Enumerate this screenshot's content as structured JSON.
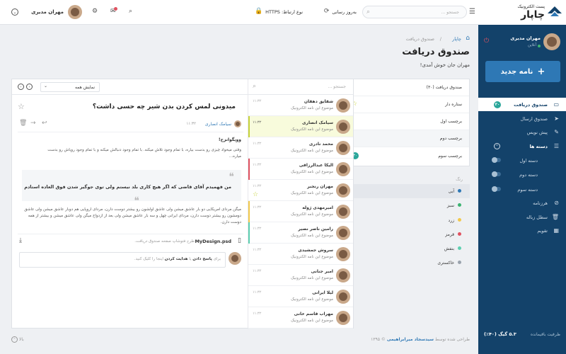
{
  "brand": {
    "tagline": "پست الکترونیک",
    "name": "چاپار"
  },
  "topbar": {
    "search_placeholder": "جستجو ...",
    "refresh_label": "به‌روز رسانی",
    "connection_label": "نوع ارتباط: HTTPS",
    "user_name": "مهران مدیری"
  },
  "sidebar": {
    "user_name": "مهران مدیری",
    "status": "آنلاین",
    "new_button": "نامه جدید",
    "items": [
      {
        "label": "صندوق دریافت",
        "icon": "inbox-icon",
        "badge": "۳۰"
      },
      {
        "label": "صندوق ارسال",
        "icon": "send-icon"
      },
      {
        "label": "پیش نویس",
        "icon": "draft-icon"
      },
      {
        "label": "دسته ها",
        "icon": "categories-icon"
      },
      {
        "label": "دسته اول",
        "icon": "dot"
      },
      {
        "label": "دسته دوم",
        "icon": "dot"
      },
      {
        "label": "دسته سوم",
        "icon": "dot"
      },
      {
        "label": "هرزنامه",
        "icon": "spam-icon"
      },
      {
        "label": "سطل زباله",
        "icon": "trash-icon"
      },
      {
        "label": "تقویم",
        "icon": "calendar-icon"
      }
    ],
    "storage_label": "ظرفیت باقیمانده",
    "storage_value": "۵.۳ گیگ (۴۰٪)"
  },
  "page": {
    "breadcrumb_home": "چاپار",
    "breadcrumb_current": "صندوق دریافت",
    "title": "صندوق دریافت",
    "subtitle": "مهران جان خوش آمدی!"
  },
  "labels_panel": {
    "header": "صندوق دریافت (۳۰)",
    "items": [
      "ستاره دار",
      "برچسب اول",
      "برچسب دوم",
      "برچسب سوم"
    ],
    "badge": "۳۰",
    "colors_title": "رنگ",
    "colors": [
      {
        "name": "آبی",
        "color": "#2e78b5"
      },
      {
        "name": "سبز",
        "color": "#3cb371"
      },
      {
        "name": "زرد",
        "color": "#f2c94c"
      },
      {
        "name": "قرمز",
        "color": "#e05260"
      },
      {
        "name": "بنفش",
        "color": "#5dcfb0"
      },
      {
        "name": "خاکستری",
        "color": "#9aa3ad"
      }
    ]
  },
  "list": {
    "search_placeholder": "جستجو ...",
    "filter_label": "نمایش همه",
    "messages": [
      {
        "name": "شقایق دهقان",
        "subject": "موضوع این نامه الکترونیک",
        "time": "۱۱:۳۲"
      },
      {
        "name": "سیامک انصاری",
        "subject": "موضوع این نامه الکترونیک",
        "time": "۱۱:۳۲"
      },
      {
        "name": "محمد نادری",
        "subject": "موضوع این نامه الکترونیک",
        "time": "۱۱:۳۲"
      },
      {
        "name": "الیکا عبدالرزاقی",
        "subject": "موضوع این نامه الکترونیک",
        "time": "۱۱:۳۲"
      },
      {
        "name": "مهران رنجبر",
        "subject": "موضوع این نامه الکترونیک",
        "time": "۱۱:۳۲"
      },
      {
        "name": "امیرمهدی ژوله",
        "subject": "موضوع این نامه الکترونیک",
        "time": "۱۱:۳۲"
      },
      {
        "name": "رامین ناصر نصیر",
        "subject": "موضوع این نامه الکترونیک",
        "time": "۱۱:۳۲"
      },
      {
        "name": "سروش جمشیدی",
        "subject": "موضوع این نامه الکترونیک",
        "time": "۱۱:۳۲"
      },
      {
        "name": "امیر جنانی",
        "subject": "موضوع این نامه الکترونیک",
        "time": "۱۱:۳۲"
      },
      {
        "name": "لیلا ایرانی",
        "subject": "موضوع این نامه الکترونیک",
        "time": "۱۱:۳۲"
      },
      {
        "name": "مهراب قاسم خانی",
        "subject": "موضوع این نامه الکترونیک",
        "time": "۱۱:۳۲"
      }
    ]
  },
  "reader": {
    "subject": "میدونی لمس کردن بدن شیر چه حسی داشت؟",
    "sender": "سیامک انصاری",
    "time": "۱۱:۳۲",
    "greeting": "وویگوانزح!",
    "body": "وقتی میخواد چیزی رو بدست بیاره، با تمام وجود تلاش میکنه. با تمام وجود دنبالش میکنه و با تمام وجود رویاش رو بدست میاره...",
    "quote1": "من فهمیدم آقای قاضی که اگر هیچ کاری بلد نیستم ولی توی جوگیر شدن فوق العاده استادم",
    "quote2": "میگن مردای امریکایی دو بار عاشق میشن ولی عاشق اولشون رو بیشتر دوست دارن، مردای اروپایی هم دوبار عاشق میشن ولی عاشق دومشون رو بیشتر دوست دارن، مردای ایرانی چهل و سه بار عاشق میشن ولی بعد از ازدواج میگن ولی عاشق میشن و بیشتر از همه دوست دارن.",
    "attachment_name": "MyDesign.psd",
    "attachment_desc": "طرح فتوشاپ صفحه صندوق دریافت.",
    "reply_prefix": "برای",
    "reply_link1": "پاسخ دادن",
    "reply_or": "یا",
    "reply_link2": "هدایت کردن",
    "reply_suffix": "اینجا را کلیک کنید."
  },
  "footer": {
    "designed_by": "طراحی شده توسط",
    "designer": "سیدسجاد میرابراهیمی",
    "year": "۱۳۹۵",
    "top_label": "بالا"
  }
}
